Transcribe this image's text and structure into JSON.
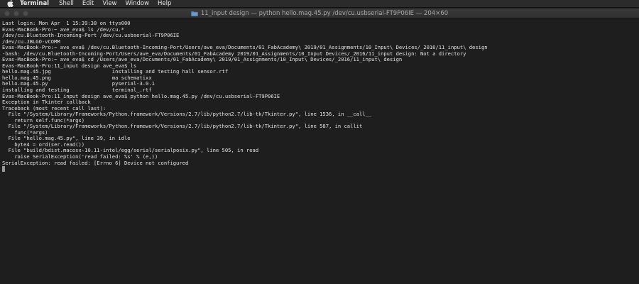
{
  "menubar": {
    "app": "Terminal",
    "items": [
      "Shell",
      "Edit",
      "View",
      "Window",
      "Help"
    ]
  },
  "window": {
    "title": "11_input design — python hello.mag.45.py /dev/cu.usbserial-FT9P06IE — 204×60"
  },
  "terminal": {
    "lines": [
      "Last login: Mon Apr  1 15:39:38 on ttys000",
      "Evas-MacBook-Pro:~ ave_eva$ ls /dev/cu.*",
      "/dev/cu.Bluetooth-Incoming-Port /dev/cu.usbserial-FT9P06IE",
      "/dev/cu.JBLGO-vCOMM",
      "Evas-MacBook-Pro:~ ave_eva$ /dev/cu.Bluetooth-Incoming-Port/Users/ave_eva/Documents/01_FabAcademy\\ 2019/01_Assignments/10_Input\\ Devices/_2016/11_input\\ design",
      "-bash: /dev/cu.Bluetooth-Incoming-Port/Users/ave_eva/Documents/01_FabAcademy 2019/01_Assignments/10_Input Devices/_2016/11_input design: Not a directory",
      "Evas-MacBook-Pro:~ ave_eva$ cd /Users/ave_eva/Documents/01_FabAcademy\\ 2019/01_Assignments/10_Input\\ Devices/_2016/11_input\\ design",
      "Evas-MacBook-Pro:11_input design ave_eva$ ls",
      "hello.mag.45.jpg                    installing and testing hall sensor.rtf",
      "hello.mag.45.png                    ma schematixx",
      "hello.mag.45.py                     pyserial-3.0.1",
      "installing and testing              terminal_.rtf",
      "Evas-MacBook-Pro:11_input design ave_eva$ python hello.mag.45.py /dev/cu.usbserial-FT9P06IE",
      "Exception in Tkinter callback",
      "Traceback (most recent call last):",
      "  File \"/System/Library/Frameworks/Python.framework/Versions/2.7/lib/python2.7/lib-tk/Tkinter.py\", line 1536, in __call__",
      "    return self.func(*args)",
      "  File \"/System/Library/Frameworks/Python.framework/Versions/2.7/lib/python2.7/lib-tk/Tkinter.py\", line 587, in callit",
      "    func(*args)",
      "  File \"hello.mag.45.py\", line 39, in idle",
      "    byte4 = ord(ser.read())",
      "  File \"build/bdist.macosx-10.11-intel/egg/serial/serialposix.py\", line 505, in read",
      "    raise SerialException('read failed: %s' % (e,))",
      "SerialException: read failed: [Errno 6] Device not configured"
    ]
  }
}
